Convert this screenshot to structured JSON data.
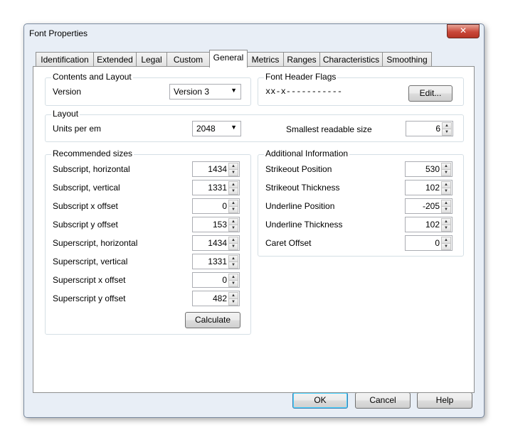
{
  "window": {
    "title": "Font Properties",
    "close_glyph": "✕"
  },
  "tabs": [
    {
      "label": "Identification"
    },
    {
      "label": "Extended"
    },
    {
      "label": "Legal"
    },
    {
      "label": "Custom"
    },
    {
      "label": "General"
    },
    {
      "label": "Metrics"
    },
    {
      "label": "Ranges"
    },
    {
      "label": "Characteristics"
    },
    {
      "label": "Smoothing"
    }
  ],
  "active_tab": "General",
  "contents_layout": {
    "group_label": "Contents and Layout",
    "version_label": "Version",
    "version_value": "Version 3"
  },
  "header_flags": {
    "group_label": "Font Header Flags",
    "flags_value": "xx-x-----------",
    "edit_label": "Edit..."
  },
  "layout": {
    "group_label": "Layout",
    "units_label": "Units per em",
    "units_value": "2048",
    "smallest_label": "Smallest readable size",
    "smallest_value": "6"
  },
  "recommended": {
    "group_label": "Recommended sizes",
    "rows": [
      {
        "label": "Subscript, horizontal",
        "value": "1434"
      },
      {
        "label": "Subscript, vertical",
        "value": "1331"
      },
      {
        "label": "Subscript x offset",
        "value": "0"
      },
      {
        "label": "Subscript y offset",
        "value": "153"
      },
      {
        "label": "Superscript, horizontal",
        "value": "1434"
      },
      {
        "label": "Superscript, vertical",
        "value": "1331"
      },
      {
        "label": "Superscript x offset",
        "value": "0"
      },
      {
        "label": "Superscript y offset",
        "value": "482"
      }
    ],
    "calculate_label": "Calculate"
  },
  "additional": {
    "group_label": "Additional Information",
    "rows": [
      {
        "label": "Strikeout Position",
        "value": "530"
      },
      {
        "label": "Strikeout Thickness",
        "value": "102"
      },
      {
        "label": "Underline Position",
        "value": "-205"
      },
      {
        "label": "Underline Thickness",
        "value": "102"
      },
      {
        "label": "Caret Offset",
        "value": "0"
      }
    ]
  },
  "footer": {
    "ok": "OK",
    "cancel": "Cancel",
    "help": "Help"
  },
  "icons": {
    "spin_up": "▲",
    "spin_down": "▼",
    "dropdown": "▼"
  }
}
